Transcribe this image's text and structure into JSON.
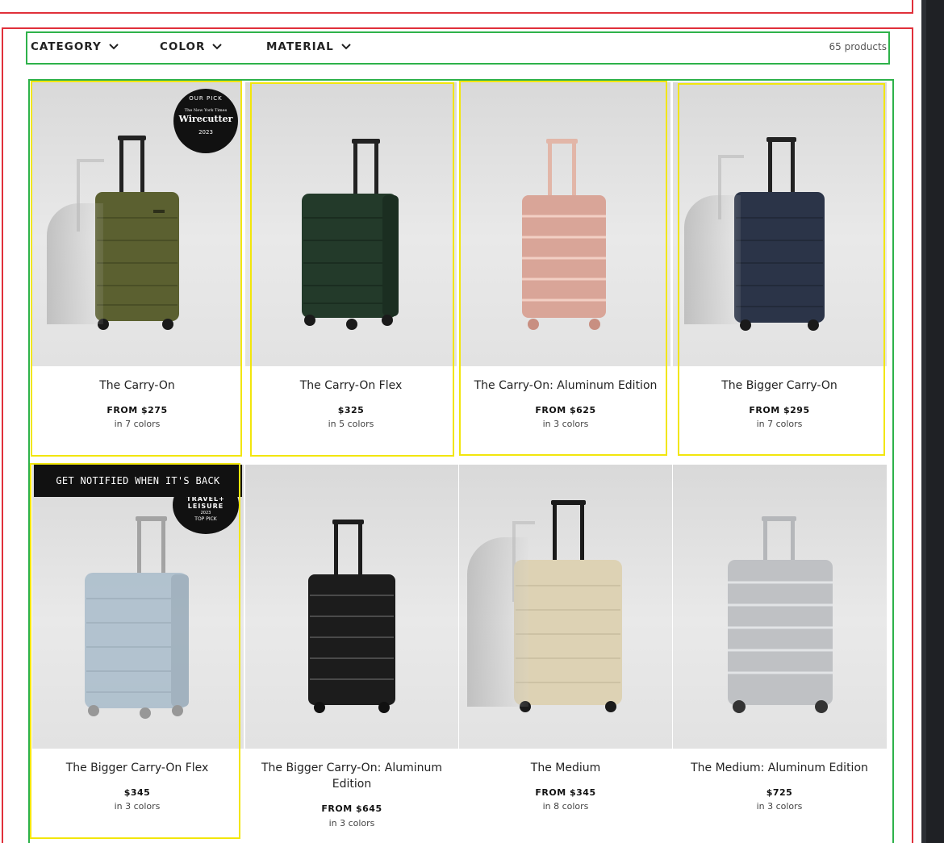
{
  "filters": {
    "category": "CATEGORY",
    "color": "COLOR",
    "material": "MATERIAL",
    "count": "65 products"
  },
  "badges": {
    "wirecutter_top": "OUR PICK",
    "wirecutter_nyt": "The New York Times",
    "wirecutter_name": "Wirecutter",
    "wirecutter_year": "2023",
    "travel_name_1": "TRAVEL+",
    "travel_name_2": "LEISURE",
    "travel_year": "2023",
    "travel_sub": "TOP PICK"
  },
  "notify_label": "GET NOTIFIED WHEN IT'S BACK",
  "products": [
    {
      "name": "The Carry-On",
      "price": "FROM $275",
      "colors": "in 7 colors",
      "color_hex": "#5b6030"
    },
    {
      "name": "The Carry-On Flex",
      "price": "$325",
      "colors": "in 5 colors",
      "color_hex": "#233a2a"
    },
    {
      "name": "The Carry-On: Aluminum Edition",
      "price": "FROM $625",
      "colors": "in 3 colors",
      "color_hex": "#d9a598"
    },
    {
      "name": "The Bigger Carry-On",
      "price": "FROM $295",
      "colors": "in 7 colors",
      "color_hex": "#2b3448"
    },
    {
      "name": "The Bigger Carry-On Flex",
      "price": "$345",
      "colors": "in 3 colors",
      "color_hex": "#a9bccb"
    },
    {
      "name": "The Bigger Carry-On: Aluminum Edition",
      "price": "FROM $645",
      "colors": "in 3 colors",
      "color_hex": "#1c1c1c"
    },
    {
      "name": "The Medium",
      "price": "FROM $345",
      "colors": "in 8 colors",
      "color_hex": "#ddd2b4"
    },
    {
      "name": "The Medium: Aluminum Edition",
      "price": "$725",
      "colors": "in 3 colors",
      "color_hex": "#bfc1c4"
    }
  ]
}
